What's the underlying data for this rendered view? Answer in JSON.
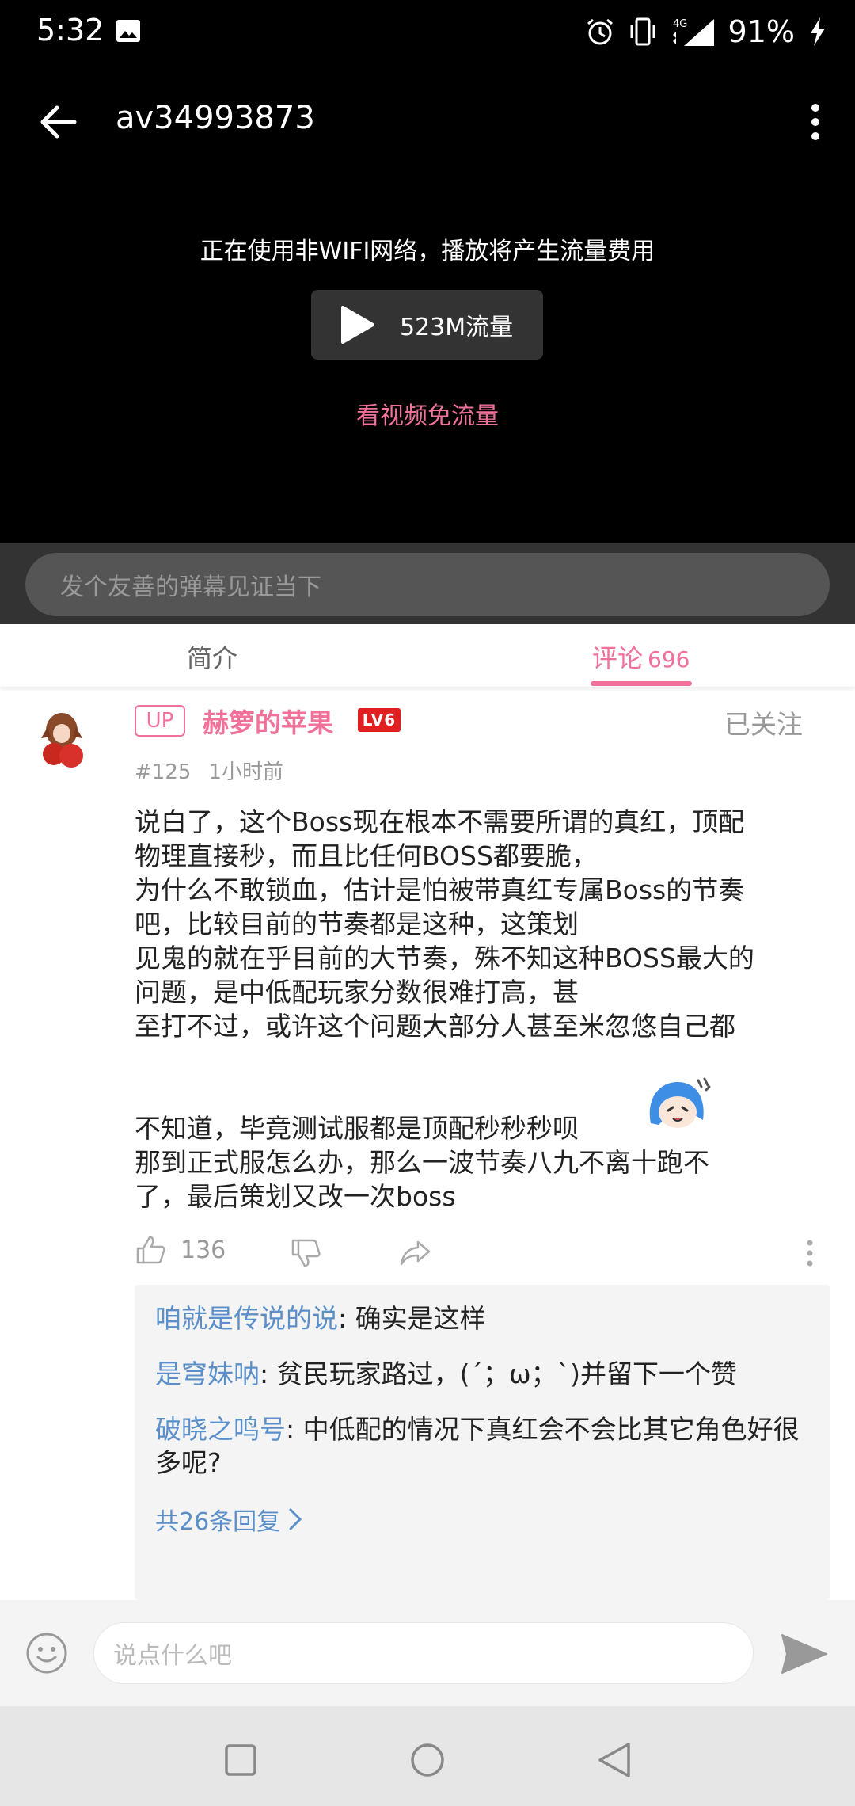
{
  "status_bar": {
    "time": "5:32",
    "network": "4G",
    "battery": "91%",
    "icons": [
      "image-icon",
      "alarm-icon",
      "vibrate-icon",
      "signal-icon",
      "charging-icon"
    ]
  },
  "video": {
    "title": "av34993873",
    "network_warning": "正在使用非WIFI网络，播放将产生流量费用",
    "play_button_label": "523M流量",
    "free_traffic_label": "看视频免流量"
  },
  "danmaku": {
    "placeholder": "发个友善的弹幕见证当下"
  },
  "tabs": {
    "intro": "简介",
    "comments": "评论",
    "comments_count": "696",
    "active": "comments"
  },
  "comment": {
    "up_badge": "UP",
    "username": "赫箩的苹果",
    "level": "LV6",
    "follow_status": "已关注",
    "floor": "#125",
    "time": "1小时前",
    "text": "说白了，这个Boss现在根本不需要所谓的真红，顶配\n物理直接秒，而且比任何BOSS都要脆，\n为什么不敢锁血，估计是怕被带真红专属Boss的节奏\n吧，比较目前的节奏都是这种，这策划\n见鬼的就在乎目前的大节奏，殊不知这种BOSS最大的\n问题，是中低配玩家分数很难打高，甚\n至打不过，或许这个问题大部分人甚至米忽悠自己都\n\n\n不知道，毕竟测试服都是顶配秒秒秒呗\n那到正式服怎么办，那么一波节奏八九不离十跑不\n了，最后策划又改一次boss",
    "like_count": "136",
    "replies": [
      {
        "name": "咱就是传说的说",
        "text": ": 确实是这样"
      },
      {
        "name": "是穹妹呐",
        "text": ": 贫民玩家路过，(´；ω；`)并留下一个赞"
      },
      {
        "name": "破晓之鸣号",
        "text": ": 中低配的情况下真红会不会比其它角色好很多呢?"
      }
    ],
    "replies_more": "共26条回复",
    "accent_color": "#f0719a",
    "link_color": "#5b8fc9"
  },
  "reply_bar": {
    "placeholder": "说点什么吧"
  }
}
